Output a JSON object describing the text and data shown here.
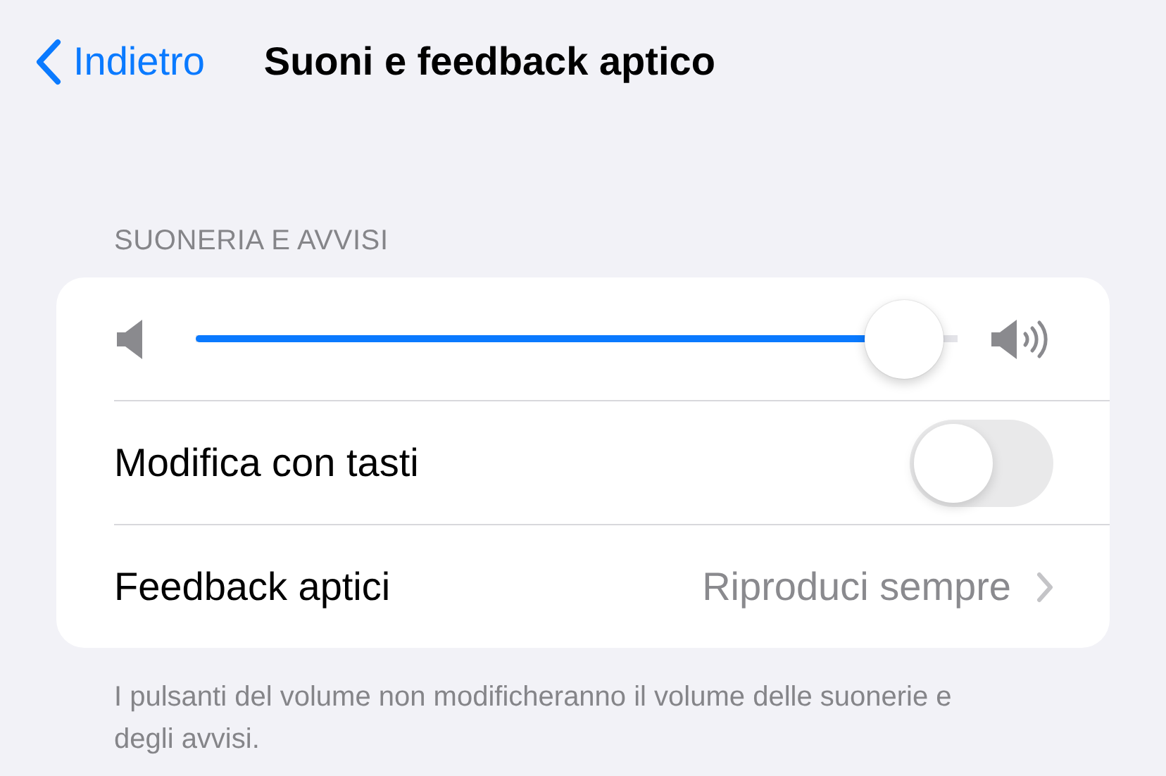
{
  "nav": {
    "back": "Indietro",
    "title": "Suoni e feedback aptico"
  },
  "section": {
    "header": "SUONERIA E AVVISI",
    "footer": "I pulsanti del volume non modificheranno il volume delle suonerie e degli avvisi."
  },
  "rows": [
    {
      "kind": "slider",
      "level": 0.93
    },
    {
      "kind": "toggle",
      "label": "Modifica con tasti",
      "on": false
    },
    {
      "kind": "link",
      "label": "Feedback aptici",
      "value": "Riproduci sempre"
    }
  ]
}
